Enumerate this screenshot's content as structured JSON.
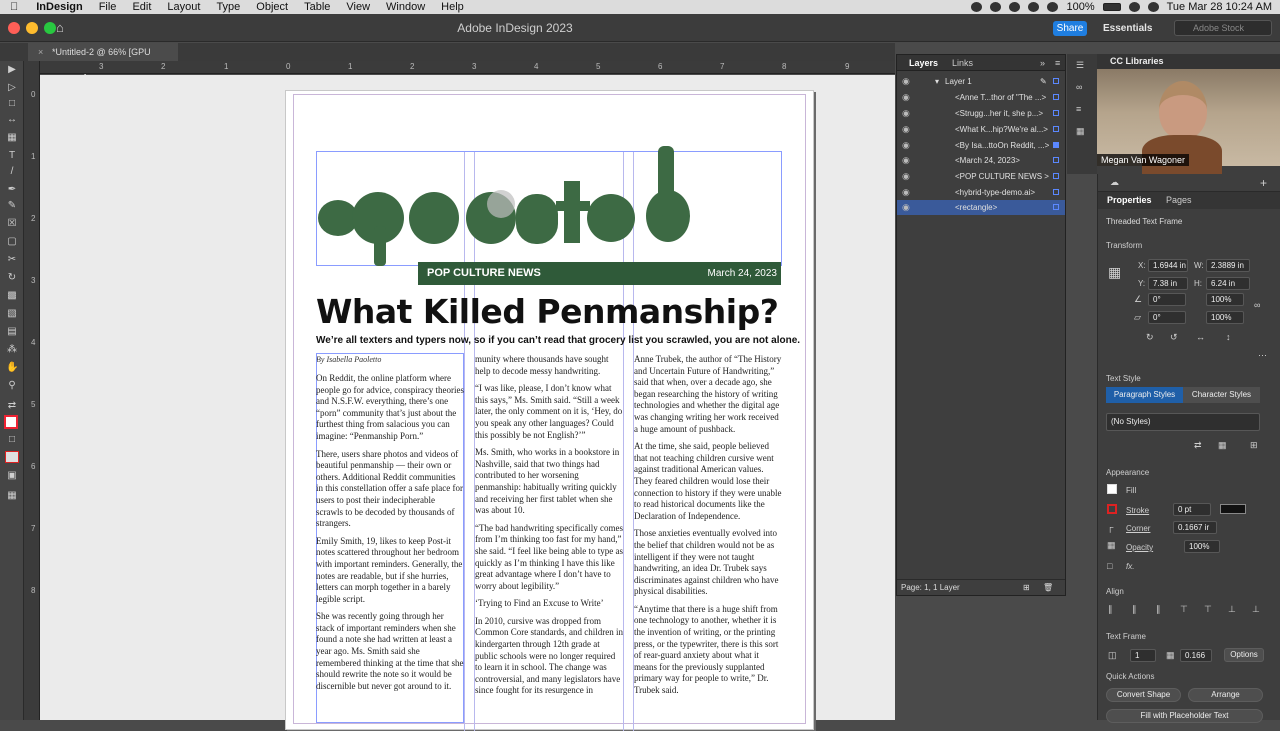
{
  "menubar": {
    "apple": "",
    "app": "InDesign",
    "items": [
      "File",
      "Edit",
      "Layout",
      "Type",
      "Object",
      "Table",
      "View",
      "Window",
      "Help"
    ],
    "battery": "100%",
    "datetime": "Tue Mar 28  10:24 AM"
  },
  "titlebar": {
    "title": "Adobe InDesign 2023",
    "share": "Share",
    "workspace": "Essentials",
    "stock_placeholder": "Adobe Stock"
  },
  "doc_tab": {
    "label": "*Untitled-2 @ 66% [GPU Preview]"
  },
  "ruler": {
    "h": [
      "3",
      "2",
      "1",
      "0",
      "1",
      "2",
      "3",
      "4",
      "5",
      "6",
      "7",
      "8",
      "9"
    ],
    "v": [
      "0",
      "1",
      "2",
      "3",
      "4",
      "5",
      "6",
      "7",
      "8"
    ]
  },
  "document": {
    "banner_left": "POP CULTURE NEWS",
    "banner_right": "March 24, 2023",
    "headline": "What Killed Penmanship?",
    "subhead": "We’re all texters and typers now, so if you can’t read that grocery list you scrawled, you are not alone.",
    "byline": "By Isabella Paoletto",
    "col1": [
      "On Reddit, the online platform where people go for advice, conspiracy theories and N.S.F.W. everything, there’s one “porn” community that’s just about the furthest thing from salacious you can imagine: “Penmanship Porn.”",
      "There, users share photos and videos of beautiful penmanship — their own or others. Additional Reddit communities in this constellation offer a safe place for users to post their indecipherable scrawls to be decoded by thousands of strangers.",
      "Emily Smith, 19, likes to keep Post-it notes scattered throughout her bedroom with important reminders. Generally, the notes are readable, but if she hurries, letters can morph together in a barely legible script.",
      "She was recently going through her stack of important reminders when she found a note she had written at least a year ago. Ms. Smith said she remembered thinking at the time that she should rewrite the note so it would be discernible but never got around to it."
    ],
    "col2": [
      "munity where thousands have sought help to decode messy handwriting.",
      "“I was like, please, I don’t know what this says,” Ms. Smith said. “Still a week later, the only comment on it is, ‘Hey, do you speak any other languages? Could this possibly be not English?’”",
      "Ms. Smith, who works in a bookstore in Nashville, said that two things had contributed to her worsening penmanship: habitually writing quickly and receiving her first tablet when she was about 10.",
      "“The bad handwriting specifically comes from I’m thinking too fast for my hand,” she said. “I feel like being able to type as quickly as I’m thinking I have this like great advantage where I don’t have to worry about legibility.”",
      "‘Trying to Find an Excuse to Write’",
      "In 2010, cursive was dropped from Common Core standards, and children in kindergarten through 12th grade at public schools were no longer required to learn it in school. The change was controversial, and many legislators have since fought for its resurgence in"
    ],
    "col3": [
      "Anne Trubek, the author of “The History and Uncertain Future of Handwriting,” said that when, over a decade ago, she began researching the history of writing technologies and whether the digital age was changing writing her work received a huge amount of pushback.",
      "At the time, she said, people believed that not teaching children cursive went against traditional American values. They feared children would lose their connection to history if they were unable to read historical documents like the Declaration of Independence.",
      "Those anxieties eventually evolved into the belief that children would not be as intelligent if they were not taught handwriting, an idea Dr. Trubek says discriminates against children who have physical disabilities.",
      "“Anytime that there is a huge shift from one technology to another, whether it is the invention of writing, or the printing press, or the typewriter, there is this sort of rear-guard anxiety about what it means for the previously supplanted primary way for people to write,” Dr. Trubek said."
    ]
  },
  "layers_panel": {
    "tab_layers": "Layers",
    "tab_links": "Links",
    "layer_name": "Layer 1",
    "items": [
      "<Anne T...thor of \"The ...>",
      "<Strugg...her it, she p...>",
      "<What K...hip?We're al...>",
      "<By Isa...ttoOn Reddit, ...>",
      "<March 24, 2023>",
      "<POP CULTURE NEWS >",
      "<hybrid-type-demo.ai>",
      "<rectangle>"
    ],
    "footer": "Page: 1, 1 Layer"
  },
  "cc_libraries": {
    "title": "CC Libraries",
    "video_name": "Megan Van Wagoner"
  },
  "properties": {
    "tab_properties": "Properties",
    "tab_pages": "Pages",
    "object_type": "Threaded Text Frame",
    "transform_label": "Transform",
    "x_label": "X:",
    "x": "1.6944 in",
    "y_label": "Y:",
    "y": "7.38 in",
    "w_label": "W:",
    "w": "2.3889 in",
    "h_label": "H:",
    "h": "6.24 in",
    "rotate": "0°",
    "shear": "0°",
    "scale_x": "100%",
    "scale_y": "100%",
    "text_style_label": "Text Style",
    "para_styles": "Paragraph Styles",
    "char_styles": "Character Styles",
    "no_styles": "(No Styles)",
    "appearance_label": "Appearance",
    "fill_label": "Fill",
    "stroke_label": "Stroke",
    "stroke_value": "0 pt",
    "corner_label": "Corner",
    "corner_value": "0.1667 ir",
    "opacity_label": "Opacity",
    "opacity_value": "100%",
    "fx": "fx.",
    "align_label": "Align",
    "text_frame_label": "Text Frame",
    "columns": "1",
    "gutter": "0.166",
    "options": "Options",
    "quick_actions_label": "Quick Actions",
    "convert_shape": "Convert Shape",
    "arrange": "Arrange",
    "fill_placeholder": "Fill with Placeholder Text"
  },
  "colors": {
    "brand_green": "#2f5a39",
    "accent_blue": "#1f7ee0"
  }
}
